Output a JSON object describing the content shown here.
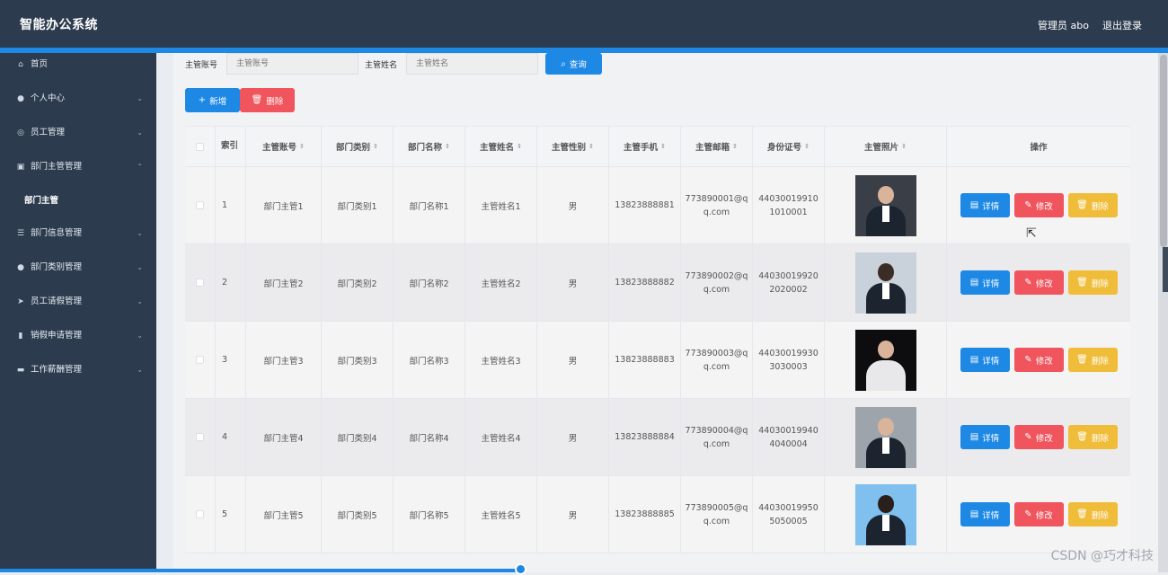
{
  "app": {
    "title": "智能办公系统",
    "user": "管理员 abo",
    "logout": "退出登录"
  },
  "sidebar": {
    "items": [
      {
        "label": "首页",
        "icon": "⌂",
        "chevron": ""
      },
      {
        "label": "个人中心",
        "icon": "●",
        "chevron": "⌄"
      },
      {
        "label": "员工管理",
        "icon": "◎",
        "chevron": "⌄"
      },
      {
        "label": "部门主管管理",
        "icon": "▣",
        "chevron": "⌃"
      },
      {
        "label": "部门信息管理",
        "icon": "☰",
        "chevron": "⌄"
      },
      {
        "label": "部门类别管理",
        "icon": "●",
        "chevron": "⌄"
      },
      {
        "label": "员工请假管理",
        "icon": "➤",
        "chevron": "⌄"
      },
      {
        "label": "销假申请管理",
        "icon": "▮",
        "chevron": "⌄"
      },
      {
        "label": "工作薪酬管理",
        "icon": "▬",
        "chevron": "⌄"
      }
    ],
    "subitem": "部门主管"
  },
  "search": {
    "account_label": "主管账号",
    "account_placeholder": "主管账号",
    "name_label": "主管姓名",
    "name_placeholder": "主管姓名",
    "query_button": "查询"
  },
  "toolbar": {
    "add": "新增",
    "delete": "删除"
  },
  "table": {
    "headers": [
      "索引",
      "主管账号",
      "部门类别",
      "部门名称",
      "主管姓名",
      "主管性别",
      "主管手机",
      "主管邮箱",
      "身份证号",
      "主管照片",
      "操作"
    ],
    "rows": [
      {
        "index": "1",
        "account": "部门主管1",
        "category": "部门类别1",
        "dept": "部门名称1",
        "name": "主管姓名1",
        "gender": "男",
        "phone": "13823888881",
        "email": "773890001@qq.com",
        "idcard": "440300199101010001"
      },
      {
        "index": "2",
        "account": "部门主管2",
        "category": "部门类别2",
        "dept": "部门名称2",
        "name": "主管姓名2",
        "gender": "男",
        "phone": "13823888882",
        "email": "773890002@qq.com",
        "idcard": "440300199202020002"
      },
      {
        "index": "3",
        "account": "部门主管3",
        "category": "部门类别3",
        "dept": "部门名称3",
        "name": "主管姓名3",
        "gender": "男",
        "phone": "13823888883",
        "email": "773890003@qq.com",
        "idcard": "440300199303030003"
      },
      {
        "index": "4",
        "account": "部门主管4",
        "category": "部门类别4",
        "dept": "部门名称4",
        "name": "主管姓名4",
        "gender": "男",
        "phone": "13823888884",
        "email": "773890004@qq.com",
        "idcard": "440300199404040004"
      },
      {
        "index": "5",
        "account": "部门主管5",
        "category": "部门类别5",
        "dept": "部门名称5",
        "name": "主管姓名5",
        "gender": "男",
        "phone": "13823888885",
        "email": "773890005@qq.com",
        "idcard": "440300199505050005"
      }
    ],
    "actions": {
      "detail": "详情",
      "edit": "修改",
      "delete": "删除"
    }
  },
  "watermark": "CSDN @巧才科技",
  "colors": {
    "primary": "#1e88e5",
    "danger": "#f0545c",
    "warning": "#f0bd3a",
    "header": "#2c3b4d"
  }
}
